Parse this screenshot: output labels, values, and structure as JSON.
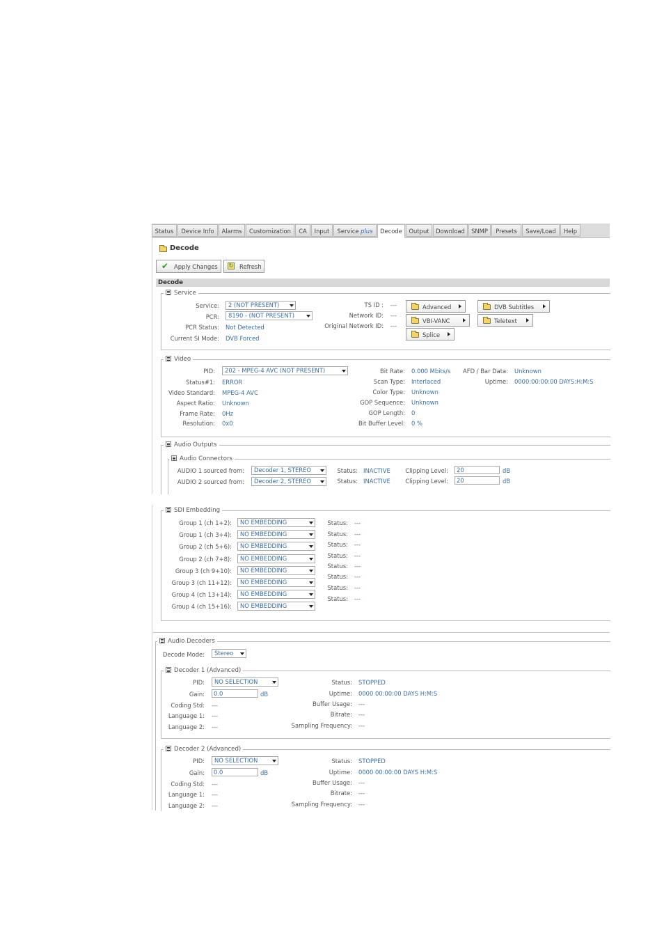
{
  "tabs": [
    "Status",
    "Device Info",
    "Alarms",
    "Customization",
    "CA",
    "Input",
    "Service",
    "Decode",
    "Output",
    "Download",
    "SNMP",
    "Presets",
    "Save/Load",
    "Help"
  ],
  "tab_service_suffix": "plus",
  "page_title": "Decode",
  "toolbar": {
    "apply_label": "Apply Changes",
    "refresh_label": "Refresh"
  },
  "section_title": "Decode",
  "service": {
    "legend": "Service",
    "service_label": "Service:",
    "service_value": "2 (NOT PRESENT)",
    "pcr_label": "PCR:",
    "pcr_value": "8190 - (NOT PRESENT)",
    "pcr_status_label": "PCR Status:",
    "pcr_status_value": "Not Detected",
    "si_mode_label": "Current SI Mode:",
    "si_mode_value": "DVB Forced",
    "tsid_label": "TS ID :",
    "tsid_value": "---",
    "netid_label": "Network ID:",
    "netid_value": "---",
    "orignet_label": "Original Network ID:",
    "orignet_value": "---",
    "nav": {
      "advanced": "Advanced",
      "dvb_subtitles": "DVB Subtitles",
      "vbi_vanc": "VBI-VANC",
      "teletext": "Teletext",
      "splice": "Splice"
    }
  },
  "video": {
    "legend": "Video",
    "pid_label": "PID:",
    "pid_value": "202 - MPEG-4 AVC (NOT PRESENT)",
    "status_label": "Status#1:",
    "status_value": "ERROR",
    "std_label": "Video Standard:",
    "std_value": "MPEG-4 AVC",
    "aspect_label": "Aspect Ratio:",
    "aspect_value": "Unknown",
    "frame_label": "Frame Rate:",
    "frame_value": "0Hz",
    "res_label": "Resolution:",
    "res_value": "0x0",
    "bitrate_label": "Bit Rate:",
    "bitrate_value": "0.000 Mbits/s",
    "scan_label": "Scan Type:",
    "scan_value": "Interlaced",
    "color_label": "Color Type:",
    "color_value": "Unknown",
    "gop_seq_label": "GOP Sequence:",
    "gop_seq_value": "Unknown",
    "gop_len_label": "GOP Length:",
    "gop_len_value": "0",
    "buffer_label": "Bit Buffer Level:",
    "buffer_value": "0 %",
    "afd_label": "AFD / Bar Data:",
    "afd_value": "Unknown",
    "uptime_label": "Uptime:",
    "uptime_value": "0000:00:00:00 DAYS:H:M:S"
  },
  "audio_outputs": {
    "legend": "Audio Outputs",
    "connectors_legend": "Audio Connectors",
    "rows": [
      {
        "label": "AUDIO 1 sourced from:",
        "source": "Decoder 1, STEREO",
        "status_label": "Status:",
        "status": "INACTIVE",
        "clip_label": "Clipping Level:",
        "clip": "20",
        "unit": "dB"
      },
      {
        "label": "AUDIO 2 sourced from:",
        "source": "Decoder 2, STEREO",
        "status_label": "Status:",
        "status": "INACTIVE",
        "clip_label": "Clipping Level:",
        "clip": "20",
        "unit": "dB"
      }
    ]
  },
  "sdi": {
    "legend": "SDI Embedding",
    "rows": [
      {
        "label": "Group 1 (ch 1+2):",
        "value": "NO EMBEDDING"
      },
      {
        "label": "Group 1 (ch 3+4):",
        "value": "NO EMBEDDING"
      },
      {
        "label": "Group 2 (ch 5+6):",
        "value": "NO EMBEDDING"
      },
      {
        "label": "Group 2 (ch 7+8):",
        "value": "NO EMBEDDING"
      },
      {
        "label": "Group 3 (ch 9+10):",
        "value": "NO EMBEDDING"
      },
      {
        "label": "Group 3 (ch 11+12):",
        "value": "NO EMBEDDING"
      },
      {
        "label": "Group 4 (ch 13+14):",
        "value": "NO EMBEDDING"
      },
      {
        "label": "Group 4 (ch 15+16):",
        "value": "NO EMBEDDING"
      }
    ],
    "status_label": "Status:",
    "status_value": "---"
  },
  "audio_decoders": {
    "legend": "Audio Decoders",
    "mode_label": "Decode Mode:",
    "mode_value": "Stereo",
    "decoders": [
      {
        "legend": "Decoder 1 (Advanced)",
        "pid_label": "PID:",
        "pid": "NO SELECTION",
        "gain_label": "Gain:",
        "gain": "0.0",
        "gain_unit": "dB",
        "coding_label": "Coding Std:",
        "coding": "---",
        "lang1_label": "Language 1:",
        "lang1": "---",
        "lang2_label": "Language 2:",
        "lang2": "---",
        "status_label": "Status:",
        "status": "STOPPED",
        "uptime_label": "Uptime:",
        "uptime": "0000 00:00:00 DAYS H:M:S",
        "buffer_label": "Buffer Usage:",
        "buffer": "---",
        "bitrate_label": "Bitrate:",
        "bitrate": "---",
        "sampling_label": "Sampling Frequency:",
        "sampling": "---"
      },
      {
        "legend": "Decoder 2 (Advanced)",
        "pid_label": "PID:",
        "pid": "NO SELECTION",
        "gain_label": "Gain:",
        "gain": "0.0",
        "gain_unit": "dB",
        "coding_label": "Coding Std:",
        "coding": "---",
        "lang1_label": "Language 1:",
        "lang1": "---",
        "lang2_label": "Language 2:",
        "lang2": "---",
        "status_label": "Status:",
        "status": "STOPPED",
        "uptime_label": "Uptime:",
        "uptime": "0000 00:00:00 DAYS H:M:S",
        "buffer_label": "Buffer Usage:",
        "buffer": "---",
        "bitrate_label": "Bitrate:",
        "bitrate": "---",
        "sampling_label": "Sampling Frequency:",
        "sampling": "---"
      }
    ]
  },
  "colors": {
    "value_blue": "#3a6ea5",
    "label_gray": "#555555",
    "apply_check": "#2e9a2e",
    "folder_yellow": "#f3d36a"
  }
}
